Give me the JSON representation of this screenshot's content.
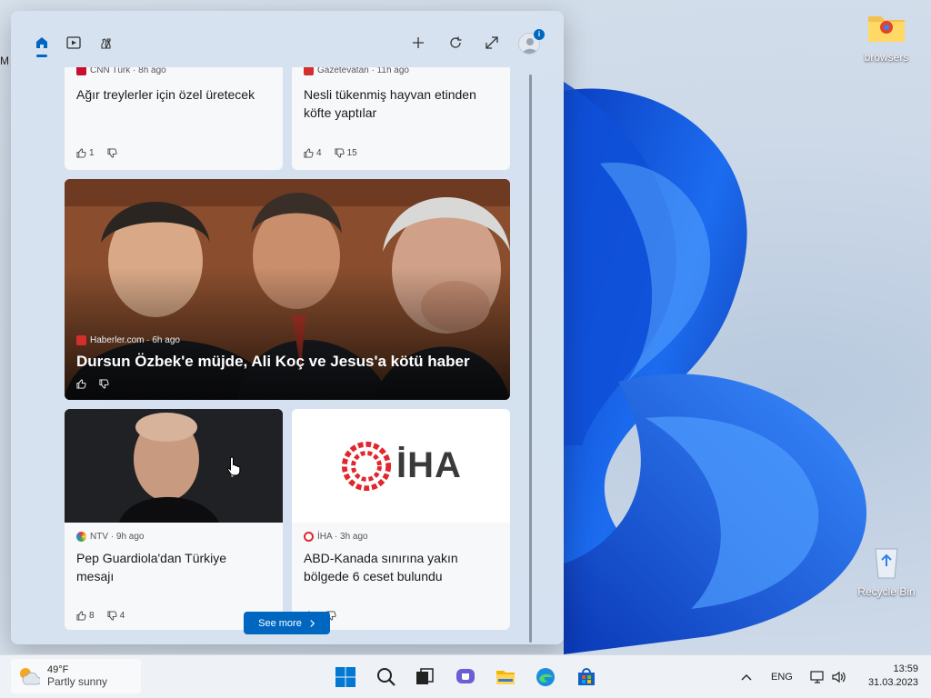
{
  "desktop": {
    "icons": [
      {
        "label": "browsers",
        "icon": "folder-icon"
      },
      {
        "label": "Recycle Bin",
        "icon": "recycle-bin-icon"
      }
    ],
    "edge_fragment": "M"
  },
  "widgets": {
    "toolbar": {
      "home": "home-icon",
      "watch": "play-icon",
      "sports": "chess-icon",
      "add": "plus-icon",
      "refresh": "refresh-icon",
      "expand": "expand-icon",
      "profile_badge": "i"
    },
    "cards": [
      {
        "source": "CNN Türk · 8h ago",
        "headline": "Ağır treylerler için özel üretecek",
        "likes": "1",
        "dislikes": ""
      },
      {
        "source": "Gazetevatan · 11h ago",
        "headline": "Nesli tükenmiş hayvan etinden köfte yaptılar",
        "likes": "4",
        "dislikes": "15"
      }
    ],
    "hero": {
      "source": "Haberler.com · 6h ago",
      "headline": "Dursun Özbek'e müjde, Ali Koç ve Jesus'a kötü haber"
    },
    "bottom_cards": [
      {
        "source": "NTV · 9h ago",
        "headline": "Pep Guardiola'dan Türkiye mesajı",
        "likes": "8",
        "dislikes": "4"
      },
      {
        "source": "İHA · 3h ago",
        "headline": "ABD-Kanada sınırına yakın bölgede 6 ceset bulundu",
        "likes": "",
        "dislikes": "",
        "logo_text": "İHA"
      }
    ],
    "see_more": "See more"
  },
  "taskbar": {
    "weather": {
      "temp": "49°F",
      "desc": "Partly sunny"
    },
    "apps": [
      "start-icon",
      "search-icon",
      "task-view-icon",
      "chat-icon",
      "file-explorer-icon",
      "edge-icon",
      "store-icon"
    ],
    "language": "ENG",
    "time": "13:59",
    "date": "31.03.2023"
  },
  "colors": {
    "accent": "#0067c0"
  }
}
